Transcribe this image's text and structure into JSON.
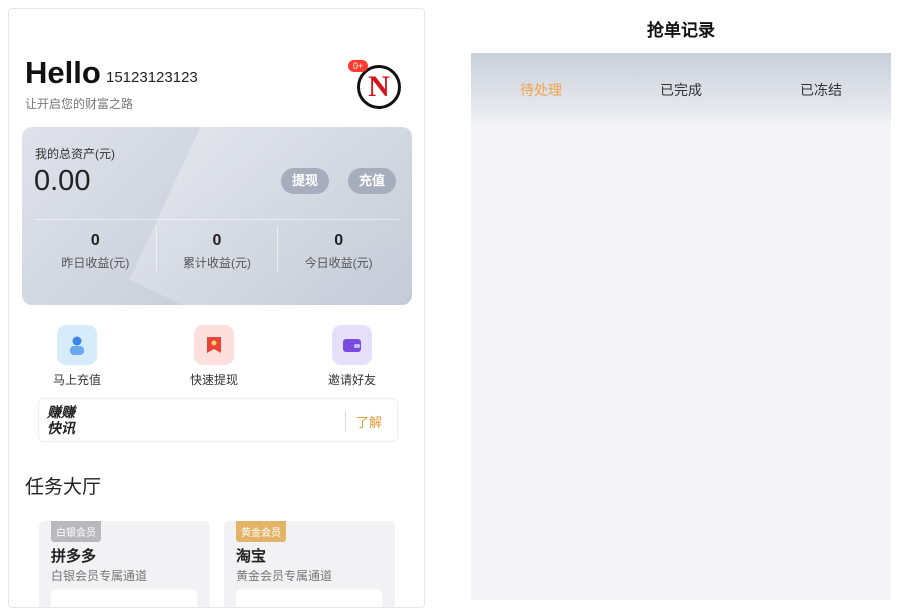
{
  "header": {
    "greeting": "Hello",
    "phone": "15123123123",
    "slogan": "让开启您的财富之路"
  },
  "avatar": {
    "badge": "0+",
    "letter": "N"
  },
  "asset_card": {
    "label": "我的总资产(元)",
    "total": "0.00",
    "withdraw_label": "提现",
    "recharge_label": "充值",
    "stats": [
      {
        "value": "0",
        "label": "昨日收益(元)"
      },
      {
        "value": "0",
        "label": "累计收益(元)"
      },
      {
        "value": "0",
        "label": "今日收益(元)"
      }
    ]
  },
  "quick_actions": [
    {
      "label": "马上充值",
      "icon": "user-wallet-icon",
      "color": "#3a86e8"
    },
    {
      "label": "快速提现",
      "icon": "bookmark-icon",
      "color": "#e8453a"
    },
    {
      "label": "邀请好友",
      "icon": "wallet-icon",
      "color": "#7b4ae0"
    }
  ],
  "news": {
    "logo_line1": "赚赚",
    "logo_line2": "快讯",
    "more_label": "了解"
  },
  "task_hall": {
    "title": "任务大厅",
    "tasks": [
      {
        "tag": "白银会员",
        "tag_color": "#b9b9bd",
        "name": "拼多多",
        "desc": "白银会员专属通道"
      },
      {
        "tag": "黄金会员",
        "tag_color": "#e3b468",
        "name": "淘宝",
        "desc": "黄金会员专属通道"
      }
    ]
  },
  "records": {
    "title": "抢单记录",
    "tabs": [
      "待处理",
      "已完成",
      "已冻结"
    ],
    "active_tab": "待处理",
    "accent": "#f0a34b"
  }
}
